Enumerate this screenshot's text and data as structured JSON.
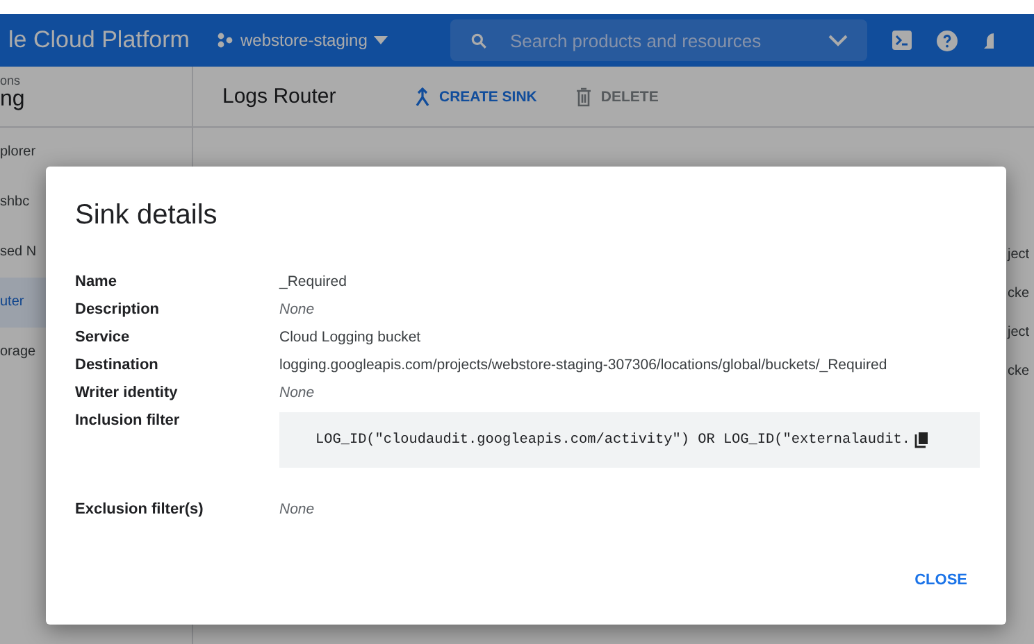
{
  "header": {
    "brand": "le Cloud Platform",
    "project": "webstore-staging",
    "search": {
      "placeholder": "Search products and resources"
    }
  },
  "sidebar": {
    "section_label": "ons",
    "title": "ng",
    "items": [
      {
        "label": "plorer",
        "selected": false
      },
      {
        "label": "shbc",
        "selected": false
      },
      {
        "label": "sed N",
        "selected": false
      },
      {
        "label": "uter",
        "selected": true
      },
      {
        "label": "orage",
        "selected": false
      }
    ]
  },
  "page": {
    "title": "Logs Router",
    "actions": [
      {
        "label": "CREATE SINK",
        "kind": "create",
        "disabled": false
      },
      {
        "label": "DELETE",
        "kind": "delete",
        "disabled": true
      }
    ],
    "table_fragments": [
      "ject",
      "cke",
      "ject",
      "cke"
    ]
  },
  "dialog": {
    "title": "Sink details",
    "fields": [
      {
        "label": "Name",
        "value": "_Required",
        "kind": "text"
      },
      {
        "label": "Description",
        "value": "None",
        "kind": "empty"
      },
      {
        "label": "Service",
        "value": "Cloud Logging bucket",
        "kind": "text"
      },
      {
        "label": "Destination",
        "value": "logging.googleapis.com/projects/webstore-staging-307306/locations/global/buckets/_Required",
        "kind": "text"
      },
      {
        "label": "Writer identity",
        "value": "None",
        "kind": "empty"
      },
      {
        "label": "Inclusion filter",
        "value": "LOG_ID(\"cloudaudit.googleapis.com/activity\") OR LOG_ID(\"externalaudit.",
        "kind": "code"
      },
      {
        "label": "Exclusion filter(s)",
        "value": "None",
        "kind": "empty"
      }
    ],
    "button": "CLOSE"
  }
}
